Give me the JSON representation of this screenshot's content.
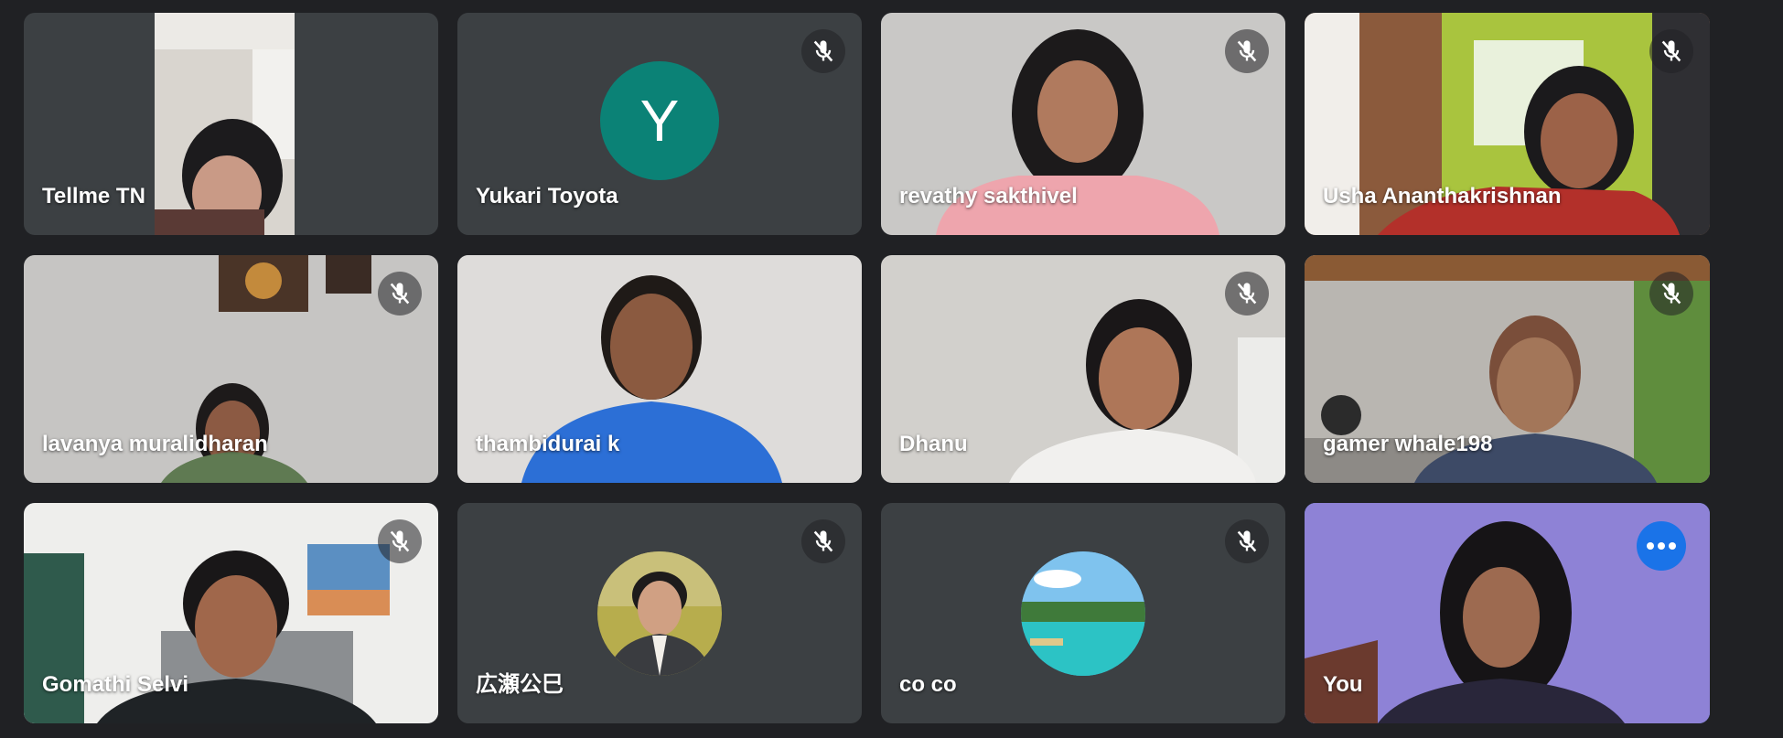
{
  "colors": {
    "background": "#202124",
    "tile_avatar_bg": "#3c4043",
    "self_border": "#4d8ef7",
    "more_button": "#1a73e8",
    "yukari_avatar": "#0b8276"
  },
  "participants": [
    {
      "name": "Tellme TN",
      "muted": false,
      "type": "video"
    },
    {
      "name": "Yukari Toyota",
      "muted": true,
      "type": "avatar-letter",
      "avatar_letter": "Y"
    },
    {
      "name": "revathy sakthivel",
      "muted": true,
      "type": "video"
    },
    {
      "name": "Usha Ananthakrishnan",
      "muted": true,
      "type": "video"
    },
    {
      "name": "lavanya muralidharan",
      "muted": true,
      "type": "video"
    },
    {
      "name": "thambidurai k",
      "muted": false,
      "type": "video"
    },
    {
      "name": "Dhanu",
      "muted": true,
      "type": "video"
    },
    {
      "name": "gamer whale198",
      "muted": true,
      "type": "video"
    },
    {
      "name": "Gomathi Selvi",
      "muted": true,
      "type": "video"
    },
    {
      "name": "広瀬公巳",
      "muted": true,
      "type": "avatar-photo"
    },
    {
      "name": "co co",
      "muted": true,
      "type": "avatar-photo"
    },
    {
      "name": "You",
      "muted": false,
      "type": "video",
      "is_self": true
    }
  ],
  "icons": {
    "mute": "mic-off-icon",
    "more": "more-options-icon"
  }
}
